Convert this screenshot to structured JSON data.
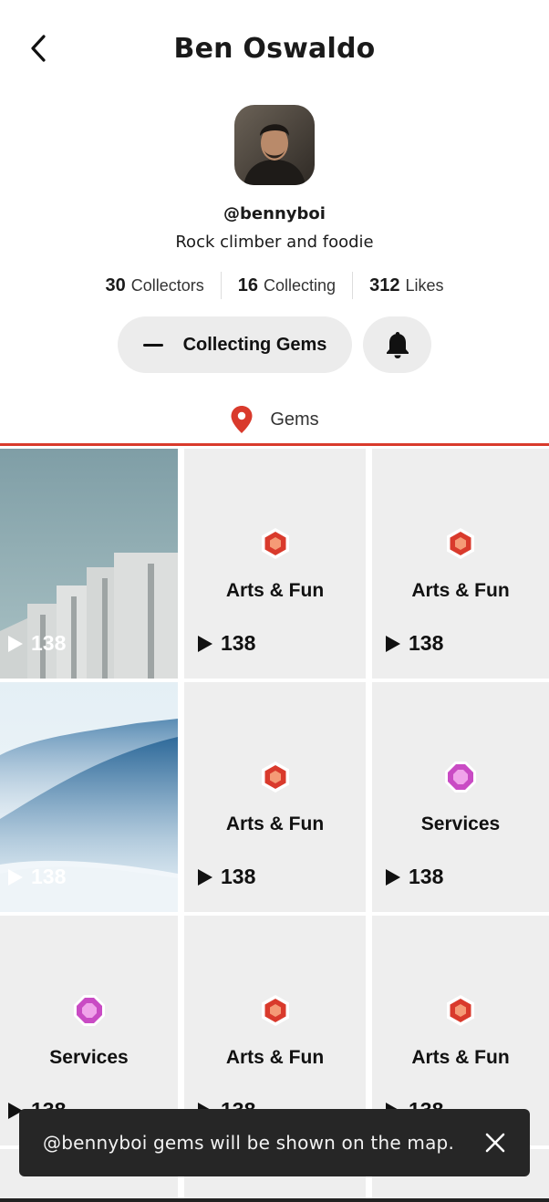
{
  "header": {
    "title": "Ben Oswaldo",
    "back_icon": "chevron-left-icon"
  },
  "profile": {
    "handle": "@bennyboi",
    "bio": "Rock climber and foodie",
    "stats": [
      {
        "value": "30",
        "label": "Collectors"
      },
      {
        "value": "16",
        "label": "Collecting"
      },
      {
        "value": "312",
        "label": "Likes"
      }
    ]
  },
  "actions": {
    "collect_label": "Collecting Gems",
    "bell_icon": "bell-icon"
  },
  "tab": {
    "label": "Gems",
    "icon": "map-pin-icon",
    "accent": "#d93a2c"
  },
  "grid": {
    "cells": [
      {
        "kind": "photo",
        "count": "138"
      },
      {
        "kind": "category",
        "category": "Arts & Fun",
        "color": "#d93a2c",
        "count": "138"
      },
      {
        "kind": "category",
        "category": "Arts & Fun",
        "color": "#d93a2c",
        "count": "138"
      },
      {
        "kind": "photo",
        "count": "138"
      },
      {
        "kind": "category",
        "category": "Arts & Fun",
        "color": "#d93a2c",
        "count": "138"
      },
      {
        "kind": "category",
        "category": "Services",
        "color": "#c94bc4",
        "count": "138"
      },
      {
        "kind": "category",
        "category": "Services",
        "color": "#c94bc4",
        "count": "138"
      },
      {
        "kind": "category",
        "category": "Arts & Fun",
        "color": "#d93a2c",
        "count": "138"
      },
      {
        "kind": "category",
        "category": "Arts & Fun",
        "color": "#d93a2c",
        "count": "138"
      }
    ]
  },
  "toast": {
    "message": "@bennyboi gems will be shown on the map.",
    "close_icon": "close-icon"
  }
}
